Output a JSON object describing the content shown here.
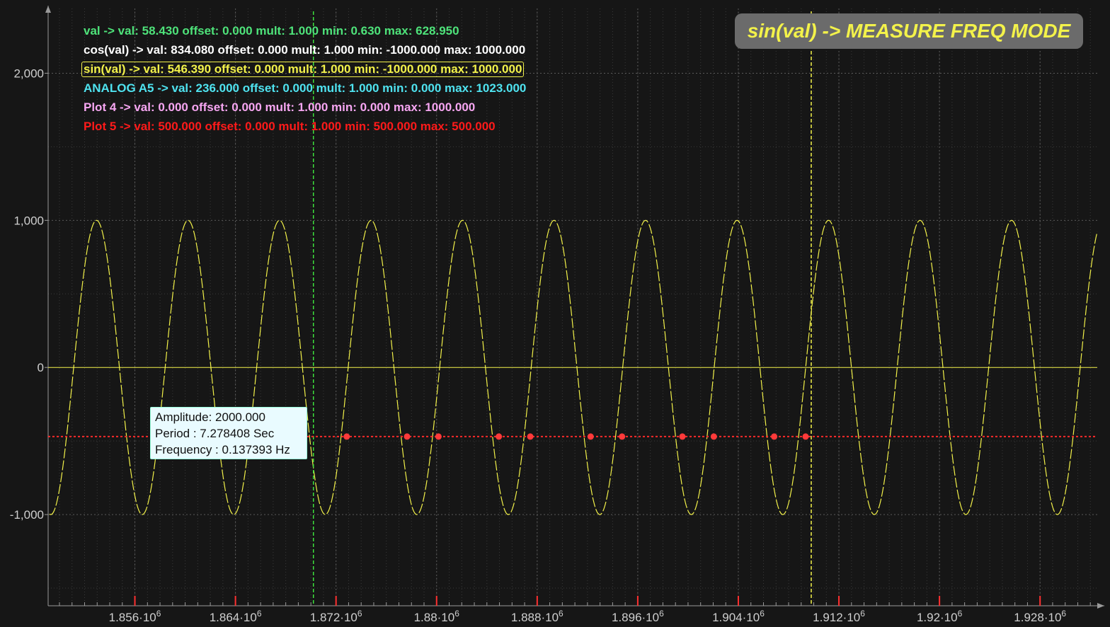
{
  "legend": [
    {
      "text": "val ->  val: 58.430 offset: 0.000 mult: 1.000 min: 0.630 max: 628.950",
      "color": "#4ee37a"
    },
    {
      "text": "cos(val) ->  val: 834.080 offset: 0.000 mult: 1.000 min: -1000.000 max: 1000.000",
      "color": "#ffffff"
    },
    {
      "text": "sin(val) ->  val: 546.390 offset: 0.000 mult: 1.000 min: -1000.000 max: 1000.000",
      "color": "#f3f24a"
    },
    {
      "text": "ANALOG A5 ->  val: 236.000 offset: 0.000 mult: 1.000 min: 0.000 max: 1023.000",
      "color": "#4fe3f0"
    },
    {
      "text": "Plot 4 ->  val: 0.000 offset: 0.000 mult: 1.000 min: 0.000 max: 1000.000",
      "color": "#f7a6f2"
    },
    {
      "text": "Plot 5 ->  val: 500.000 offset: 0.000 mult: 1.000 min: 500.000 max: 500.000",
      "color": "#ff1a1a"
    }
  ],
  "mode_badge": "sin(val) -> MEASURE FREQ MODE",
  "measure": {
    "amplitude": "Amplitude: 2000.000",
    "period": "Period : 7.278408 Sec",
    "frequency": "Frequency : 0.137393 Hz"
  },
  "colors": {
    "background": "#161616",
    "signal": "#f3f24a",
    "measure_line": "#ff2a2a",
    "green_cursor": "#3ee23e",
    "yellow_cursor": "#f3f24a",
    "grid": "#5a5a5a"
  },
  "chart_data": {
    "type": "line",
    "title": "",
    "xlabel": "",
    "ylabel": "",
    "x_tick_labels": [
      {
        "mantissa": "1.856",
        "exp": "6"
      },
      {
        "mantissa": "1.864",
        "exp": "6"
      },
      {
        "mantissa": "1.872",
        "exp": "6"
      },
      {
        "mantissa": "1.88",
        "exp": "6"
      },
      {
        "mantissa": "1.888",
        "exp": "6"
      },
      {
        "mantissa": "1.896",
        "exp": "6"
      },
      {
        "mantissa": "1.904",
        "exp": "6"
      },
      {
        "mantissa": "1.912",
        "exp": "6"
      },
      {
        "mantissa": "1.92",
        "exp": "6"
      },
      {
        "mantissa": "1.928",
        "exp": "6"
      }
    ],
    "x_ticks": [
      1856000,
      1864000,
      1872000,
      1880000,
      1888000,
      1896000,
      1904000,
      1912000,
      1920000,
      1928000
    ],
    "y_ticks": [
      -1000,
      0,
      1000,
      2000
    ],
    "y_tick_labels": [
      "-1,000",
      "0",
      "1,000",
      "2,000"
    ],
    "xlim": [
      1849100,
      1932550
    ],
    "ylim": [
      -1620,
      2440
    ],
    "series": [
      {
        "amplitude": 1000,
        "period": 7278.408,
        "phase_peak_x": 1852950,
        "baseline": 0
      }
    ],
    "cursors": {
      "green_x": 1870200,
      "yellow_x": 1909800
    },
    "measure_level": -470,
    "measure_markers_x": [
      1872850,
      1877650,
      1880150,
      1884950,
      1887450,
      1892250,
      1894750,
      1899550,
      1902050,
      1906850,
      1909350
    ]
  }
}
